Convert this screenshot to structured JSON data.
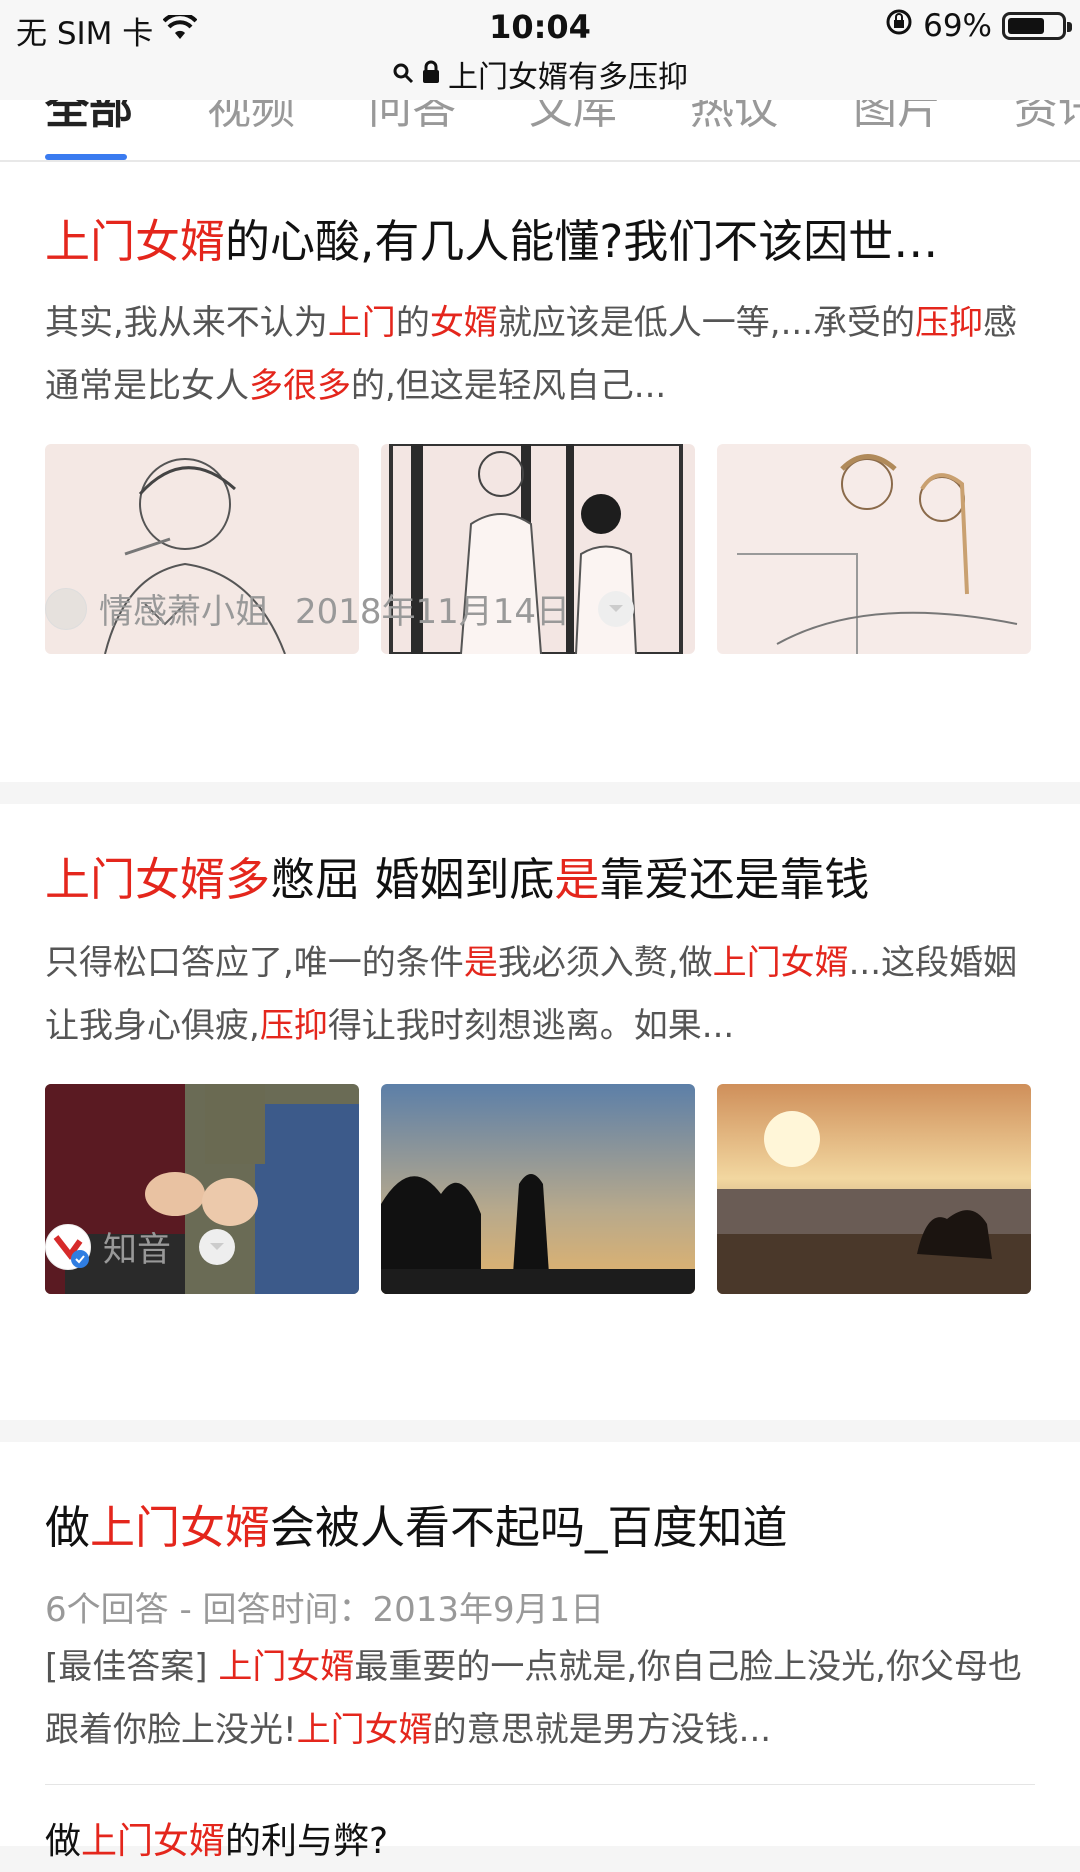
{
  "status_bar": {
    "carrier": "无 SIM 卡",
    "time": "10:04",
    "battery": "69%",
    "battery_level": 0.69
  },
  "url_bar": {
    "query": "上门女婿有多压抑"
  },
  "tabs": [
    {
      "label": "全部",
      "active": true
    },
    {
      "label": "视频"
    },
    {
      "label": "问答"
    },
    {
      "label": "文库"
    },
    {
      "label": "热议"
    },
    {
      "label": "图片"
    },
    {
      "label": "资讯"
    }
  ],
  "results": [
    {
      "title_parts": [
        {
          "t": "上门女婿",
          "hl": true
        },
        {
          "t": "的心酸,有几人能懂?我们不该因世…",
          "hl": false
        }
      ],
      "snippet_parts": [
        {
          "t": "其实,我从来不认为",
          "hl": false
        },
        {
          "t": "上门",
          "hl": true
        },
        {
          "t": "的",
          "hl": false
        },
        {
          "t": "女婿",
          "hl": true
        },
        {
          "t": "就应该是低人一等,...承受的",
          "hl": false
        },
        {
          "t": "压抑",
          "hl": true
        },
        {
          "t": "感通常是比女人",
          "hl": false
        },
        {
          "t": "多很多",
          "hl": true
        },
        {
          "t": "的,但这是轻风自己...",
          "hl": false
        }
      ],
      "author": "情感萧小姐",
      "date": "2018年11月14日"
    },
    {
      "title_parts": [
        {
          "t": "上门女婿多",
          "hl": true
        },
        {
          "t": "憋屈 婚姻到底",
          "hl": false
        },
        {
          "t": "是",
          "hl": true
        },
        {
          "t": "靠爱还是靠钱",
          "hl": false
        }
      ],
      "snippet_parts": [
        {
          "t": "只得松口答应了,唯一的条件",
          "hl": false
        },
        {
          "t": "是",
          "hl": true
        },
        {
          "t": "我必须入赘,做",
          "hl": false
        },
        {
          "t": "上门女婿",
          "hl": true
        },
        {
          "t": "...这段婚姻让我身心俱疲,",
          "hl": false
        },
        {
          "t": "压抑",
          "hl": true
        },
        {
          "t": "得让我时刻想逃离。如果...",
          "hl": false
        }
      ],
      "author": "知音"
    },
    {
      "title_parts": [
        {
          "t": "做",
          "hl": false
        },
        {
          "t": "上门女婿",
          "hl": true
        },
        {
          "t": "会被人看不起吗_百度知道",
          "hl": false
        }
      ],
      "qa_meta": "6个回答 - 回答时间：2013年9月1日",
      "snippet_parts": [
        {
          "t": "[最佳答案] ",
          "hl": false
        },
        {
          "t": "上门女婿",
          "hl": true
        },
        {
          "t": "最重要的一点就是,你自己脸上没光,你父母也跟着你脸上没光!",
          "hl": false
        },
        {
          "t": "上门女婿",
          "hl": true
        },
        {
          "t": "的意思就是男方没钱...",
          "hl": false
        }
      ],
      "sub_title_parts": [
        {
          "t": "做",
          "hl": false
        },
        {
          "t": "上门女婿",
          "hl": true
        },
        {
          "t": "的利与弊?",
          "hl": false
        }
      ]
    }
  ],
  "icons": {
    "wifi": "wifi-icon",
    "lock": "lock-icon",
    "search": "search-icon",
    "rotation": "rotation-lock-icon",
    "dropdown": "chevron-down-icon",
    "verified": "verified-badge-icon"
  },
  "colors": {
    "highlight": "#e4261c",
    "tab_active": "#3a7bf0"
  }
}
